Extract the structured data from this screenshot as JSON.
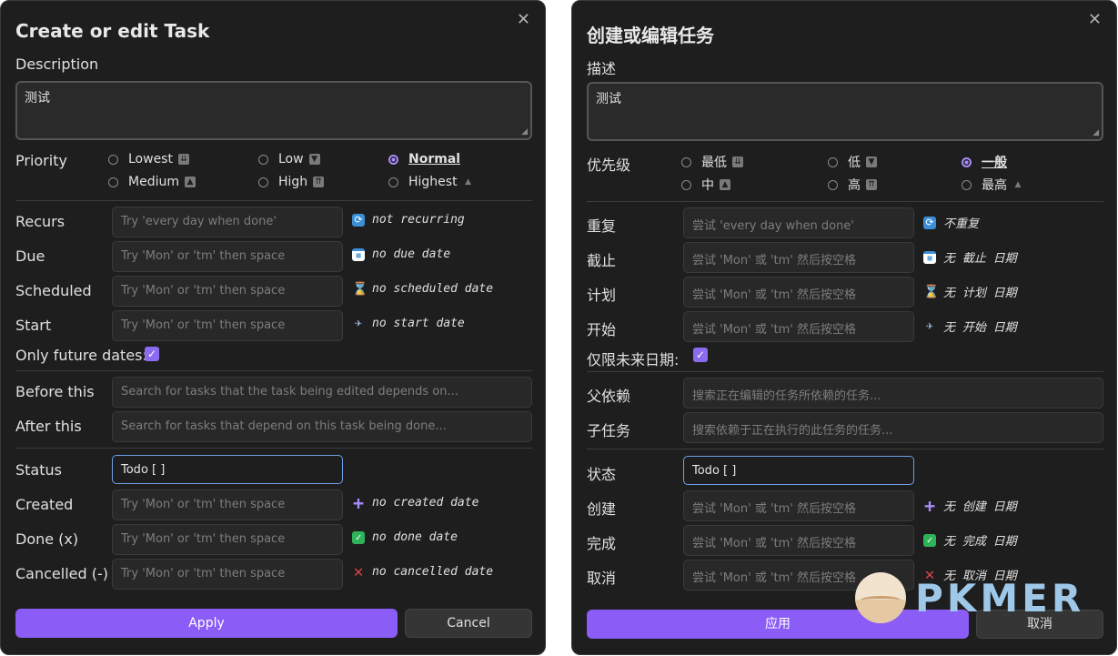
{
  "en": {
    "title": "Create or edit Task",
    "close": "✕",
    "description_label": "Description",
    "description_value": "测试",
    "priority_label": "Priority",
    "priorities": [
      {
        "label": "Lowest",
        "icon": "⏬"
      },
      {
        "label": "Low",
        "icon": "🔽"
      },
      {
        "label": "Normal",
        "icon": ""
      },
      {
        "label": "Medium",
        "icon": "🔼"
      },
      {
        "label": "High",
        "icon": "⏫"
      },
      {
        "label": "Highest",
        "icon": "🔺"
      }
    ],
    "selected_priority": "Normal",
    "recurs_label": "Recurs",
    "recurs_placeholder": "Try 'every day when done'",
    "recurs_info": "not recurring",
    "due_label": "Due",
    "date_placeholder": "Try 'Mon' or 'tm' then space",
    "due_info": "no due date",
    "scheduled_label": "Scheduled",
    "scheduled_info": "no scheduled date",
    "start_label": "Start",
    "start_info": "no start date",
    "only_future_label": "Only future dates:",
    "only_future_checked": true,
    "before_label": "Before this",
    "before_placeholder": "Search for tasks that the task being edited depends on...",
    "after_label": "After this",
    "after_placeholder": "Search for tasks that depend on this task being done...",
    "status_label": "Status",
    "status_value": "Todo [ ]",
    "created_label": "Created",
    "created_info": "no created date",
    "done_label": "Done (x)",
    "done_info": "no done date",
    "cancelled_label": "Cancelled (-)",
    "cancelled_info": "no cancelled date",
    "apply": "Apply",
    "cancel": "Cancel"
  },
  "zh": {
    "title": "创建或编辑任务",
    "close": "✕",
    "description_label": "描述",
    "description_value": "测试",
    "priority_label": "优先级",
    "priorities": [
      {
        "label": "最低",
        "icon": "⏬"
      },
      {
        "label": "低",
        "icon": "🔽"
      },
      {
        "label": "一般",
        "icon": ""
      },
      {
        "label": "中",
        "icon": "🔼"
      },
      {
        "label": "高",
        "icon": "⏫"
      },
      {
        "label": "最高",
        "icon": "🔺"
      }
    ],
    "selected_priority": "一般",
    "recurs_label": "重复",
    "recurs_placeholder": "尝试 'every day when done'",
    "recurs_info": "不重复",
    "due_label": "截止",
    "date_placeholder": "尝试 'Mon' 或 'tm' 然后按空格",
    "due_info": "无 截止 日期",
    "scheduled_label": "计划",
    "scheduled_info": "无 计划 日期",
    "start_label": "开始",
    "start_info": "无 开始 日期",
    "only_future_label": "仅限未来日期:",
    "only_future_checked": true,
    "before_label": "父依赖",
    "before_placeholder": "搜索正在编辑的任务所依赖的任务...",
    "after_label": "子任务",
    "after_placeholder": "搜索依赖于正在执行的此任务的任务...",
    "status_label": "状态",
    "status_value": "Todo [ ]",
    "created_label": "创建",
    "created_info": "无 创建 日期",
    "done_label": "完成",
    "done_info": "无 完成 日期",
    "cancelled_label": "取消",
    "cancelled_info": "无 取消 日期",
    "apply": "应用",
    "cancel": "取消"
  },
  "watermark": {
    "text": "PKMER"
  },
  "colors": {
    "accent": "#8b5cf6",
    "status_border": "#6fa0e6",
    "checkbox": "#8b6cf0"
  }
}
